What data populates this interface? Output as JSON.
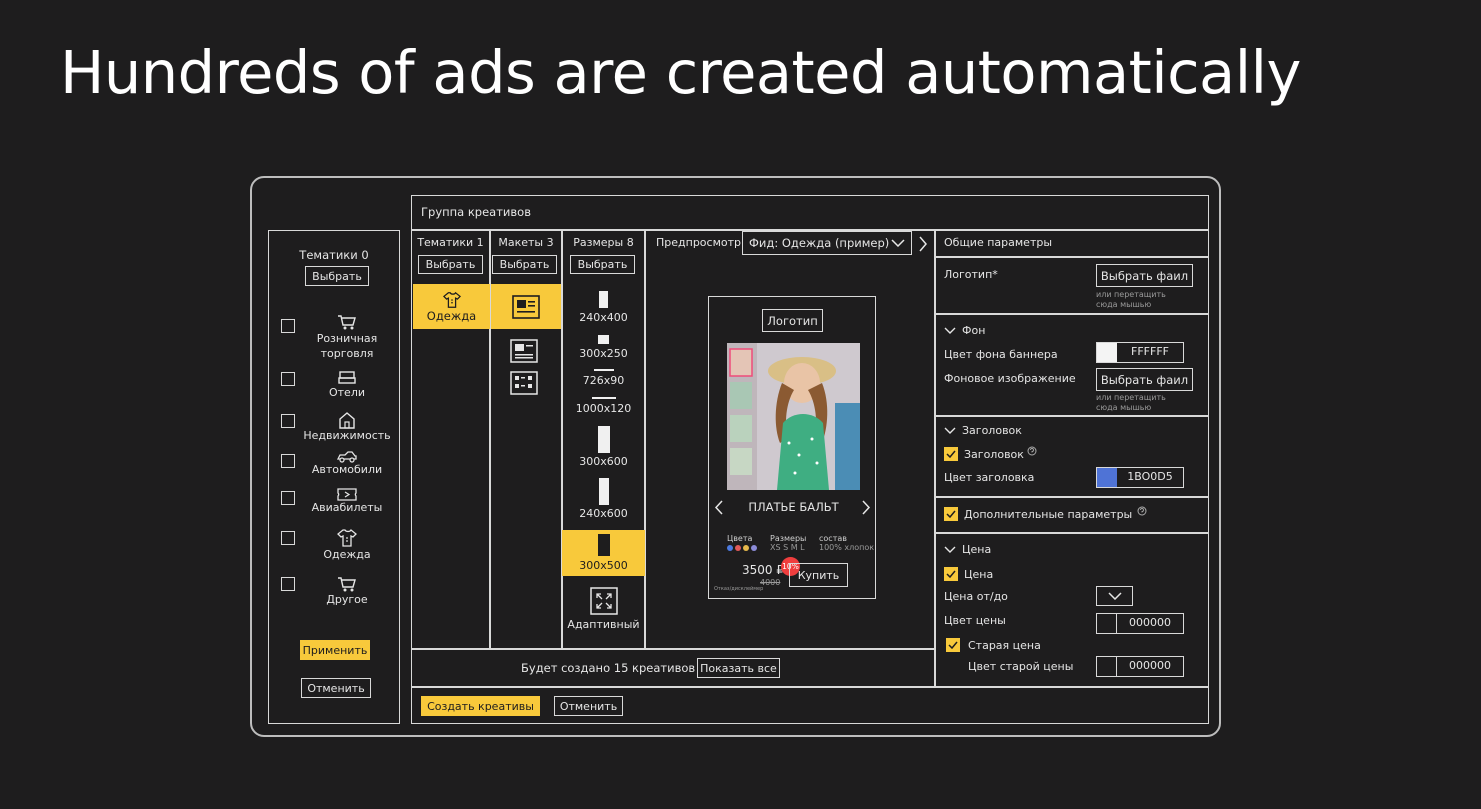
{
  "slide": {
    "title": "Hundreds of ads are created automatically"
  },
  "colors": {
    "accent": "#f8c93b",
    "background": "#1e1d1e",
    "badge": "#ef3e3e",
    "header_swatch": "#1B00D5",
    "outline": "#d9d9d9"
  },
  "sidebar": {
    "title": "Тематики 0",
    "select_label": "Выбрать",
    "items": [
      {
        "icon": "cart-icon",
        "label": "Розничная\nторговля"
      },
      {
        "icon": "bed-icon",
        "label": "Отели"
      },
      {
        "icon": "house-icon",
        "label": "Недвижимость"
      },
      {
        "icon": "car-icon",
        "label": "Автомобили"
      },
      {
        "icon": "ticket-icon",
        "label": "Авиабилеты"
      },
      {
        "icon": "shirt-icon",
        "label": "Одежда"
      },
      {
        "icon": "cart-icon",
        "label": "Другое"
      }
    ],
    "apply_label": "Применить",
    "cancel_label": "Отменить"
  },
  "main": {
    "group_title": "Группа креативов",
    "columns": {
      "themes": {
        "title": "Тематики 1",
        "select_label": "Выбрать",
        "selected_label": "Одежда"
      },
      "layouts": {
        "title": "Макеты 3",
        "select_label": "Выбрать"
      },
      "sizes": {
        "title": "Размеры 8",
        "select_label": "Выбрать",
        "items": [
          "240x400",
          "300x250",
          "726x90",
          "1000x120",
          "300x600",
          "240x600",
          "300x500",
          "Адаптивный"
        ],
        "selected": "300x500"
      }
    },
    "preview": {
      "label": "Предпросмотр",
      "feed_label": "Фид: Одежда (пример)",
      "logo_label": "Логотип",
      "product_name": "ПЛАТЬЕ БАЛЬТ",
      "colors_label": "Цвета",
      "sizes_label": "Размеры",
      "sizes_value": "XS S M L",
      "composition_label": "состав",
      "composition_value": "100% хлопок",
      "price": "3500 ₽",
      "old_price": "4000",
      "discount": "10%",
      "buy_label": "Купить",
      "disclaimer": "Отказ/дисклеймер"
    },
    "footer": {
      "count_text": "Будет создано 15 креативов",
      "show_all_label": "Показать все"
    },
    "actions": {
      "create_label": "Создать креативы",
      "cancel_label": "Отменить"
    }
  },
  "params": {
    "title": "Общие параметры",
    "logo_label": "Логотип*",
    "choose_file_label": "Выбрать фаил",
    "drop_hint": "или перетащить\nсюда мышью",
    "bg_section": "Фон",
    "bg_color_label": "Цвет фона баннера",
    "bg_color_value": "FFFFFF",
    "bg_image_label": "Фоновое изображение",
    "bg_choose_label": "Выбрать фаил",
    "bg_drop_hint": "или перетащить\nсюда мышью",
    "header_section": "Заголовок",
    "header_checkbox": "Заголовок",
    "header_color_label": "Цвет заголовка",
    "header_color_value": "1BO0D5",
    "extra_params": "Дополнительные параметры",
    "price_section": "Цена",
    "price_checkbox": "Цена",
    "price_range_label": "Цена от/до",
    "price_color_label": "Цвет цены",
    "price_color_value": "000000",
    "old_price_checkbox": "Старая цена",
    "old_price_color_label": "Цвет старой цены",
    "old_price_color_value": "000000"
  }
}
